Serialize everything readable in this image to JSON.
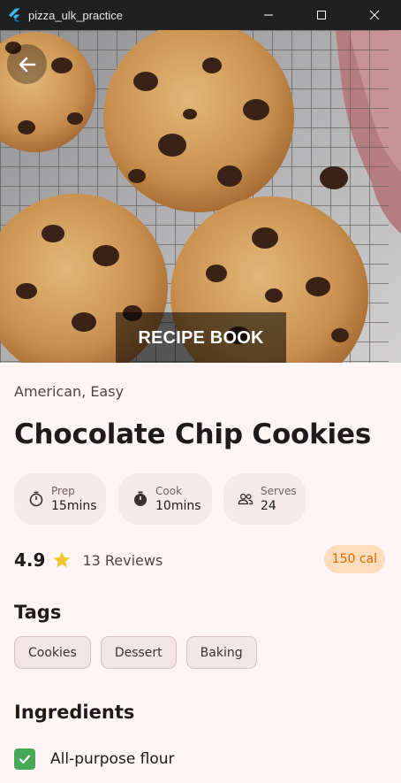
{
  "window": {
    "title": "pizza_ulk_practice"
  },
  "hero": {
    "banner": "RECIPE BOOK"
  },
  "recipe": {
    "subtitle": "American, Easy",
    "title": "Chocolate Chip Cookies",
    "stats": [
      {
        "label": "Prep",
        "value": "15mins",
        "icon": "timer-icon"
      },
      {
        "label": "Cook",
        "value": "10mins",
        "icon": "stopwatch-icon"
      },
      {
        "label": "Serves",
        "value": "24",
        "icon": "people-icon"
      }
    ],
    "rating": "4.9",
    "reviews": "13 Reviews",
    "calories": "150 cal"
  },
  "tags": {
    "heading": "Tags",
    "items": [
      "Cookies",
      "Dessert",
      "Baking"
    ]
  },
  "ingredients": {
    "heading": "Ingredients",
    "items": [
      {
        "label": "All-purpose flour",
        "checked": true
      }
    ]
  },
  "colors": {
    "background": "#fff5f4",
    "titlebar": "#202020",
    "chip": "#f6e9ea",
    "calorie_bg": "#ffdcbc",
    "calorie_text": "#e06a00",
    "checkbox": "#47a857",
    "star": "#f7c62f"
  }
}
